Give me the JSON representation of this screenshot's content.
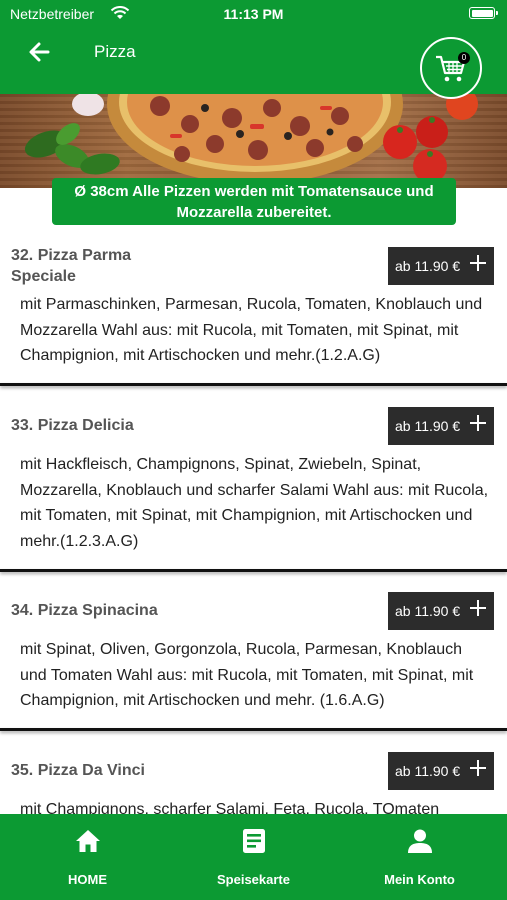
{
  "status_bar": {
    "carrier": "Netzbetreiber",
    "time": "11:13 PM"
  },
  "nav": {
    "title": "Pizza",
    "cart_count": "0"
  },
  "banner": {
    "info": "Ø 38cm Alle Pizzen werden mit Tomatensauce und Mozzarella zubereitet."
  },
  "items": [
    {
      "title": "32. Pizza Parma Speciale",
      "price": "ab 11.90 €",
      "description": "mit Parmaschinken, Parmesan, Rucola, Tomaten, Knoblauch und Mozzarella Wahl aus: mit Rucola, mit Tomaten, mit Spinat, mit Champignion, mit Artischocken und mehr.(1.2.A.G)"
    },
    {
      "title": "33. Pizza Delicia",
      "price": "ab 11.90 €",
      "description": "mit Hackfleisch, Champignons, Spinat, Zwiebeln, Spinat, Mozzarella, Knoblauch und scharfer Salami Wahl aus: mit Rucola, mit Tomaten, mit Spinat, mit Champignion, mit Artischocken und mehr.(1.2.3.A.G)"
    },
    {
      "title": "34. Pizza Spinacina",
      "price": "ab 11.90 €",
      "description": "mit Spinat, Oliven, Gorgonzola, Rucola, Parmesan, Knoblauch und Tomaten Wahl aus: mit Rucola, mit Tomaten, mit Spinat, mit Champignion, mit Artischocken und mehr. (1.6.A.G)"
    },
    {
      "title": "35. Pizza Da Vinci",
      "price": "ab 11.90 €",
      "description": "mit Champignons, scharfer Salami, Feta, Rucola, TOmaten"
    }
  ],
  "tabs": [
    {
      "label": "HOME",
      "icon": "home-icon"
    },
    {
      "label": "Speisekarte",
      "icon": "menu-list-icon"
    },
    {
      "label": "Mein Konto",
      "icon": "user-icon"
    }
  ],
  "colors": {
    "brand_green": "#0c9a33",
    "price_button": "#2c2c2c"
  }
}
